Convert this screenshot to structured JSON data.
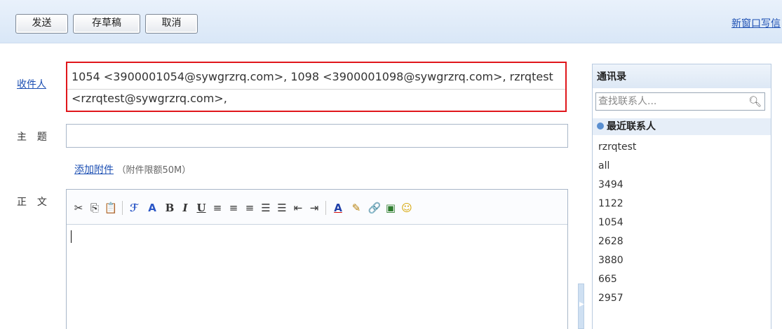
{
  "toolbar": {
    "send": "发送",
    "draft": "存草稿",
    "cancel": "取消",
    "new_window": "新窗口写信"
  },
  "compose": {
    "to_label": "收件人",
    "to_value": "1054 <3900001054@sywgrzrq.com>, 1098 <3900001098@sywgrzrq.com>, rzrqtest <rzrqtest@sywgrzrq.com>,",
    "subject_label": "主  题",
    "subject_value": "",
    "attach_link": "添加附件",
    "attach_note": "（附件限额50M）",
    "body_label": "正  文",
    "body_value": ""
  },
  "editor_tools": [
    "cut-icon",
    "copy-icon",
    "paste-icon",
    "font-family-icon",
    "font-size-icon",
    "bold-icon",
    "italic-icon",
    "underline-icon",
    "align-left-icon",
    "align-center-icon",
    "align-right-icon",
    "ordered-list-icon",
    "unordered-list-icon",
    "outdent-icon",
    "indent-icon",
    "font-color-icon",
    "highlight-icon",
    "link-icon",
    "image-icon",
    "emoticon-icon"
  ],
  "contacts": {
    "title": "通讯录",
    "search_placeholder": "查找联系人...",
    "group": "最近联系人",
    "items": [
      "rzrqtest",
      "all",
      "3494",
      "1122",
      "1054",
      "2628",
      "3880",
      "665",
      "2957"
    ]
  }
}
